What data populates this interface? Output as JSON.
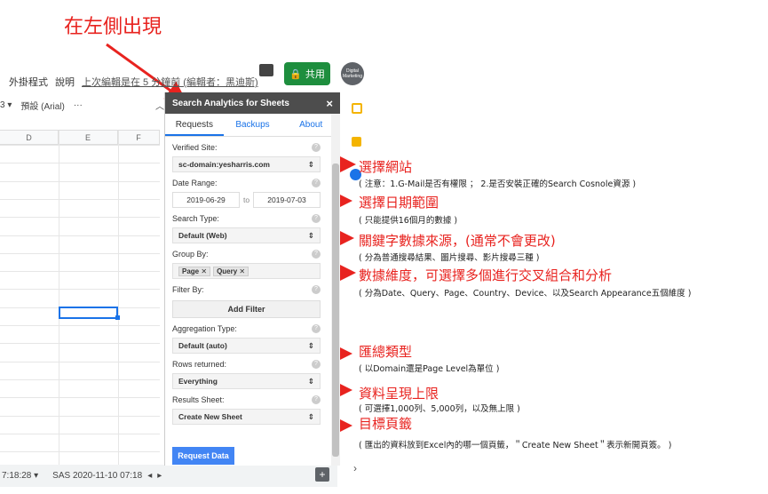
{
  "top_annotation": "在左側出現",
  "menubar": {
    "items": [
      "外掛程式",
      "說明"
    ],
    "last_edit": "上次編輯是在 5 分鐘前 (編輯者：黑迪斯)"
  },
  "share_label": "共用",
  "avatar_text": "Digital Marketing",
  "toolbar": {
    "zoom_suffix": "3 ▾",
    "font": "預設 (Arial)",
    "more": "···",
    "collapse": "︿"
  },
  "grid": {
    "columns": [
      "D",
      "E",
      "F"
    ]
  },
  "bottombar": {
    "sheet1": "7:18:28 ▾",
    "sheet2": "SAS 2020-11-10 07:18",
    "nav_prev": "◂",
    "nav_next": "▸",
    "add": "+"
  },
  "panel": {
    "title": "Search Analytics for Sheets",
    "close": "×",
    "tabs": [
      "Requests",
      "Backups",
      "About"
    ],
    "verified_site_label": "Verified Site:",
    "verified_site_value": "sc-domain:yesharris.com",
    "date_range_label": "Date Range:",
    "date_from": "2019-06-29",
    "date_to_label": "to",
    "date_to": "2019-07-03",
    "search_type_label": "Search Type:",
    "search_type_value": "Default (Web)",
    "group_by_label": "Group By:",
    "group_chips": [
      "Page",
      "Query"
    ],
    "filter_by_label": "Filter By:",
    "add_filter": "Add Filter",
    "aggregation_label": "Aggregation Type:",
    "aggregation_value": "Default (auto)",
    "rows_label": "Rows returned:",
    "rows_value": "Everything",
    "results_label": "Results Sheet:",
    "results_value": "Create New Sheet",
    "request_button": "Request Data",
    "help_glyph": "?",
    "select_glyph": "⇕",
    "chip_x": "✕"
  },
  "annotations": [
    {
      "title": "選擇網站",
      "sub": "( 注意：1.G-Mail是否有權限 ； 2.是否安裝正確的Search Cosnole資源 )"
    },
    {
      "title": "選擇日期範圍",
      "sub": "( 只能提供16個月的數據 )"
    },
    {
      "title": "關鍵字數據來源，(通常不會更改)",
      "sub": "( 分為普通搜尋結果、圖片搜尋、影片搜尋三種 )"
    },
    {
      "title": "數據維度，可選擇多個進行交叉組合和分析",
      "sub": "( 分為Date、Query、Page、Country、Device、以及Search Appearance五個維度 )"
    },
    {
      "title": "匯總類型",
      "sub": "( 以Domain還是Page Level為單位 )"
    },
    {
      "title": "資料呈現上限",
      "sub": "( 可選擇1,000列、5,000列，以及無上限 )"
    },
    {
      "title": "目標頁籤",
      "sub": "( 匯出的資料放到Excel內的哪一個頁籤，＂Create New Sheet＂表示新開頁簽。 )"
    }
  ],
  "colors": {
    "accent_red": "#e8231f",
    "share_green": "#1e8e3e",
    "panel_header": "#4d4d4d",
    "link_blue": "#1a73e8"
  }
}
